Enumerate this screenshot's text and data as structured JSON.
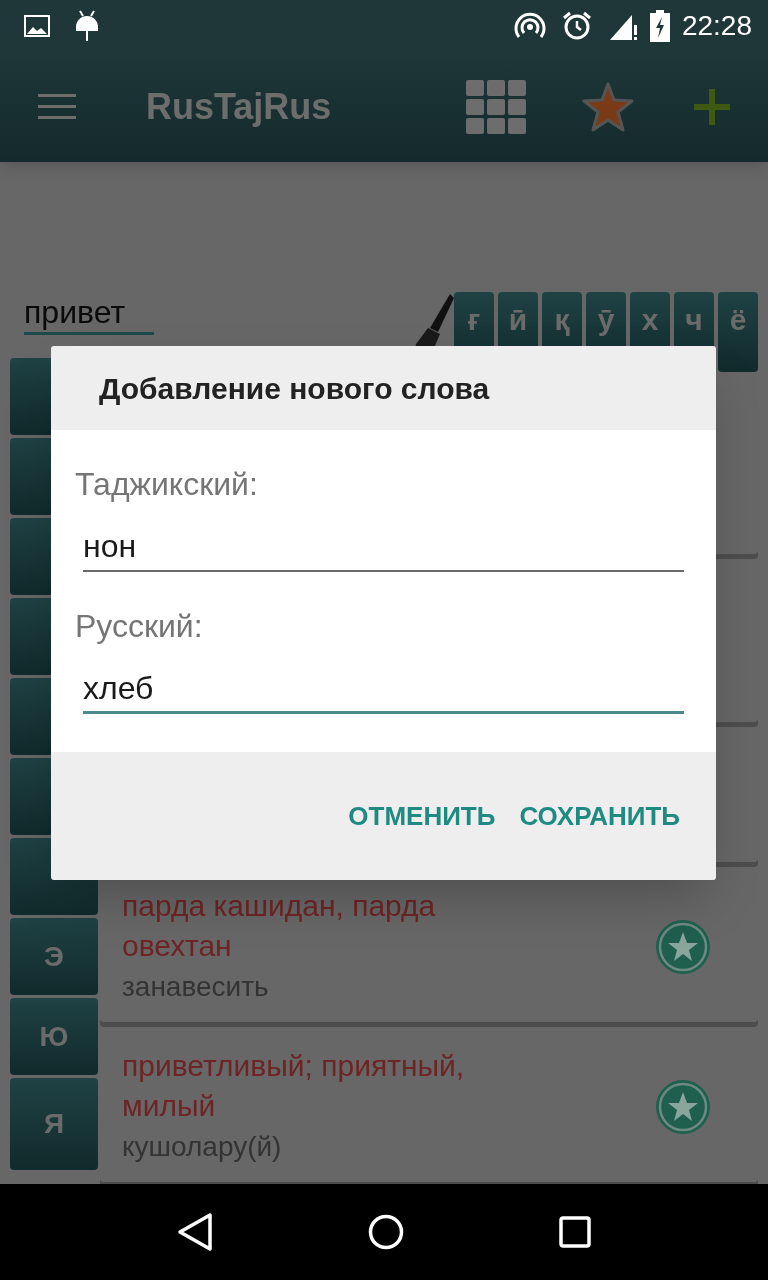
{
  "status_bar": {
    "time": "22:28"
  },
  "app_bar": {
    "title": "RusTajRus"
  },
  "search": {
    "value": "привет"
  },
  "top_keys": [
    {
      "label": "ғ"
    },
    {
      "label": "ӣ"
    },
    {
      "label": "қ"
    },
    {
      "label": "ӯ"
    },
    {
      "label": "х"
    },
    {
      "label": "ч"
    },
    {
      "label": "ё"
    }
  ],
  "side_keys": [
    {
      "label": "Э"
    },
    {
      "label": "Ю"
    },
    {
      "label": "Я"
    }
  ],
  "entries": [
    {
      "tajik": "парда кашидан, парда овехтан",
      "russian": "занавесить"
    },
    {
      "tajik": "приветливый; приятный, милый",
      "russian": "кушолару(й)"
    }
  ],
  "dialog": {
    "title": "Добавление нового слова",
    "fields": [
      {
        "label": "Таджикский:",
        "value": "нон",
        "focused": false
      },
      {
        "label": "Русский:",
        "value": "хлеб",
        "focused": true
      }
    ],
    "buttons": [
      "ОТМЕНИТЬ",
      "СОХРАНИТЬ"
    ]
  }
}
